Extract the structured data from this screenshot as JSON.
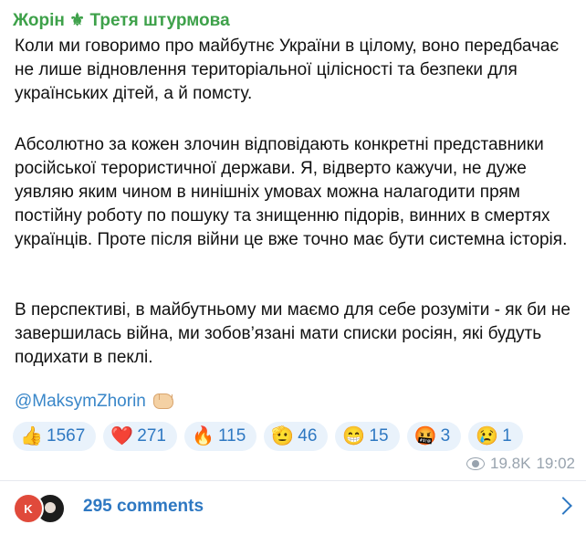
{
  "post": {
    "channel_name": "Жорін ⚜ Третя штурмова",
    "paragraphs": [
      "Коли ми говоримо про майбутнє України в цілому, воно передбачає не лише відновлення територіальної цілісності та безпеки для українських дітей, а й помсту.",
      "Абсолютно за кожен злочин відповідають конкретні представники російської терористичної держави. Я, відверто кажучи, не дуже уявляю яким чином в нинішніх умовах можна налагодити прям постійну роботу по пошуку та знищенню підорів, винних в смертях українців. Проте після війни це вже точно має бути системна історія.",
      "В перспективі, в майбутньому ми маємо для себе розуміти - як би не завершилась війна, ми зобов’язані мати списки росіян, які будуть подихати в пеклі."
    ],
    "mention": "@MaksymZhorin",
    "mention_emoji": "fist-bump-icon"
  },
  "reactions": [
    {
      "emoji": "👍",
      "icon": "thumbs-up-icon",
      "count": "1567"
    },
    {
      "emoji": "❤️",
      "icon": "heart-icon",
      "count": "271"
    },
    {
      "emoji": "🔥",
      "icon": "fire-icon",
      "count": "115"
    },
    {
      "emoji": "🫡",
      "icon": "pointing-hand-icon",
      "count": "46"
    },
    {
      "emoji": "😁",
      "icon": "grin-icon",
      "count": "15"
    },
    {
      "emoji": "🤬",
      "icon": "swearing-face-icon",
      "count": "3"
    },
    {
      "emoji": "😢",
      "icon": "crying-face-icon",
      "count": "1"
    }
  ],
  "meta": {
    "views": "19.8K",
    "time": "19:02"
  },
  "comments": {
    "avatar_letter": "K",
    "label": "295 comments"
  },
  "colors": {
    "channel_name": "#3ea14a",
    "link": "#2e78c2",
    "reaction_bg": "#e9f2fb",
    "meta": "#98a3ae"
  }
}
